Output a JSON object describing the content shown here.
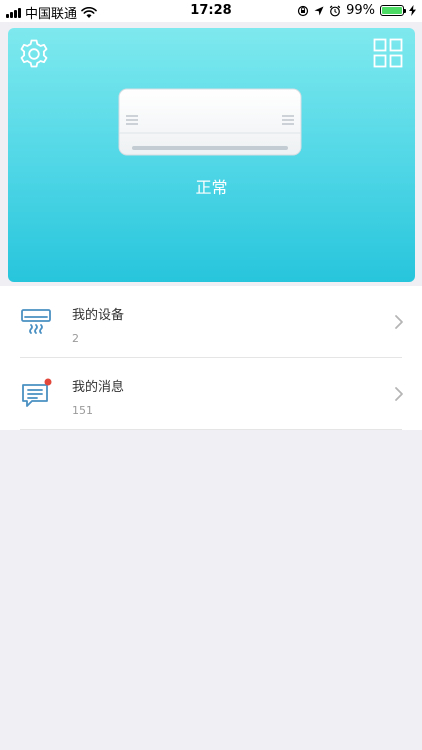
{
  "status_bar": {
    "carrier": "中国联通",
    "time": "17:28",
    "battery_percent": "99%",
    "battery_level": 0.99
  },
  "hero": {
    "device_status": "正常",
    "gradient_top": "#7ee9ee",
    "gradient_bottom": "#27c5dc"
  },
  "list": {
    "items": [
      {
        "label": "我的设备",
        "count": "2",
        "icon": "air-conditioner-icon"
      },
      {
        "label": "我的消息",
        "count": "151",
        "icon": "message-icon",
        "has_unread_dot": true
      }
    ]
  },
  "colors": {
    "icon_blue": "#4a90c2",
    "badge_red": "#e2473b",
    "page_background": "#efeff4"
  }
}
